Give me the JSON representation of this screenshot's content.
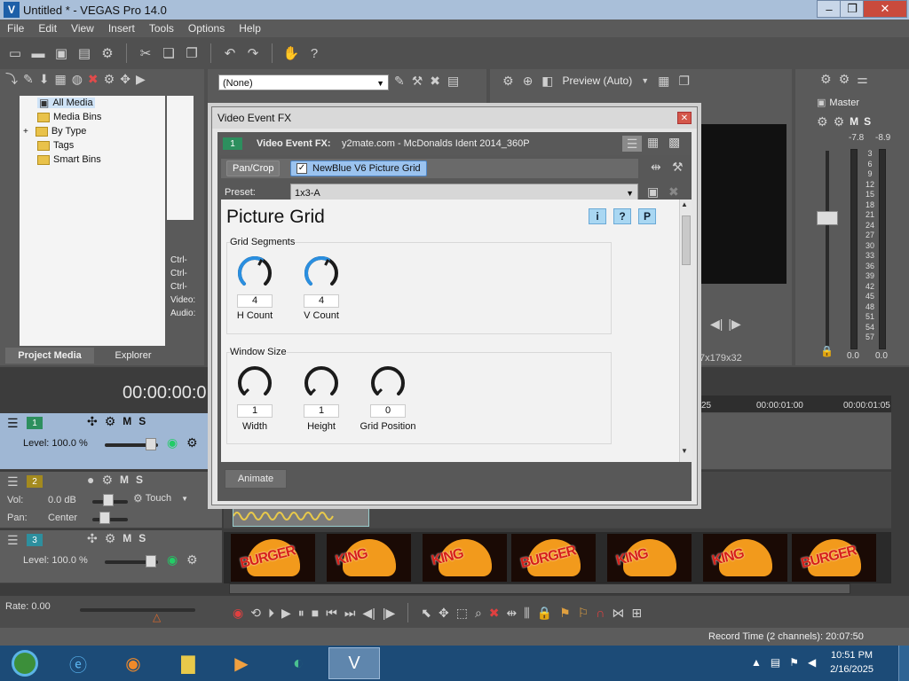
{
  "window": {
    "title": "Untitled * - VEGAS Pro 14.0"
  },
  "menu": [
    "File",
    "Edit",
    "View",
    "Insert",
    "Tools",
    "Options",
    "Help"
  ],
  "media_tree": {
    "items": [
      "All Media",
      "Media Bins",
      "By Type",
      "Tags",
      "Smart Bins"
    ],
    "tabs": [
      "Project Media",
      "Explorer"
    ],
    "side_labels": [
      "Ctrl-",
      "Ctrl-",
      "Ctrl-",
      "Video:",
      "Audio:"
    ]
  },
  "fx_chain_preset": "(None)",
  "preview": {
    "quality": "Preview (Auto)",
    "info": "7x179x32"
  },
  "master": {
    "label": "Master",
    "left_db": "-7.8",
    "right_db": "-8.9",
    "left_peak": "0.0",
    "right_peak": "0.0",
    "scale": [
      "3",
      "6",
      "9",
      "12",
      "15",
      "18",
      "21",
      "24",
      "27",
      "30",
      "33",
      "36",
      "39",
      "42",
      "45",
      "48",
      "51",
      "54",
      "57"
    ]
  },
  "dialog": {
    "title": "Video Event FX",
    "header_label": "Video Event FX:",
    "header_value": "y2mate.com - McDonalds Ident 2014_360P",
    "track_num": "1",
    "chain": [
      "Pan/Crop",
      "NewBlue V6 Picture Grid"
    ],
    "preset_label": "Preset:",
    "preset_value": "1x3-A",
    "plugin_title": "Picture Grid",
    "info_buttons": [
      "i",
      "?",
      "P"
    ],
    "groups": [
      {
        "label": "Grid Segments",
        "knobs": [
          {
            "value": "4",
            "label": "H Count",
            "level": 0.6
          },
          {
            "value": "4",
            "label": "V Count",
            "level": 0.6
          }
        ]
      },
      {
        "label": "Window Size",
        "knobs": [
          {
            "value": "1",
            "label": "Width",
            "level": 0.0
          },
          {
            "value": "1",
            "label": "Height",
            "level": 0.0
          },
          {
            "value": "0",
            "label": "Grid Position",
            "level": 0.0
          }
        ]
      }
    ],
    "animate": "Animate"
  },
  "timeline": {
    "timecode": "00:00:00:0",
    "ruler": [
      "25",
      "00:00:01:00",
      "00:00:01:05"
    ],
    "tracks": [
      {
        "num": "1",
        "label": "Level: 100.0 %"
      },
      {
        "num": "2",
        "vol_label": "Vol:",
        "vol": "0.0 dB",
        "pan_label": "Pan:",
        "pan": "Center",
        "mode": "Touch"
      },
      {
        "num": "3",
        "label": "Level: 100.0 %"
      }
    ],
    "clip_text": [
      "BURGER",
      "KING"
    ]
  },
  "transport": {
    "rate": "Rate: 0.00"
  },
  "status": {
    "record_time": "Record Time (2 channels): 20:07:50"
  },
  "taskbar": {
    "time": "10:51 PM",
    "date": "2/16/2025"
  }
}
